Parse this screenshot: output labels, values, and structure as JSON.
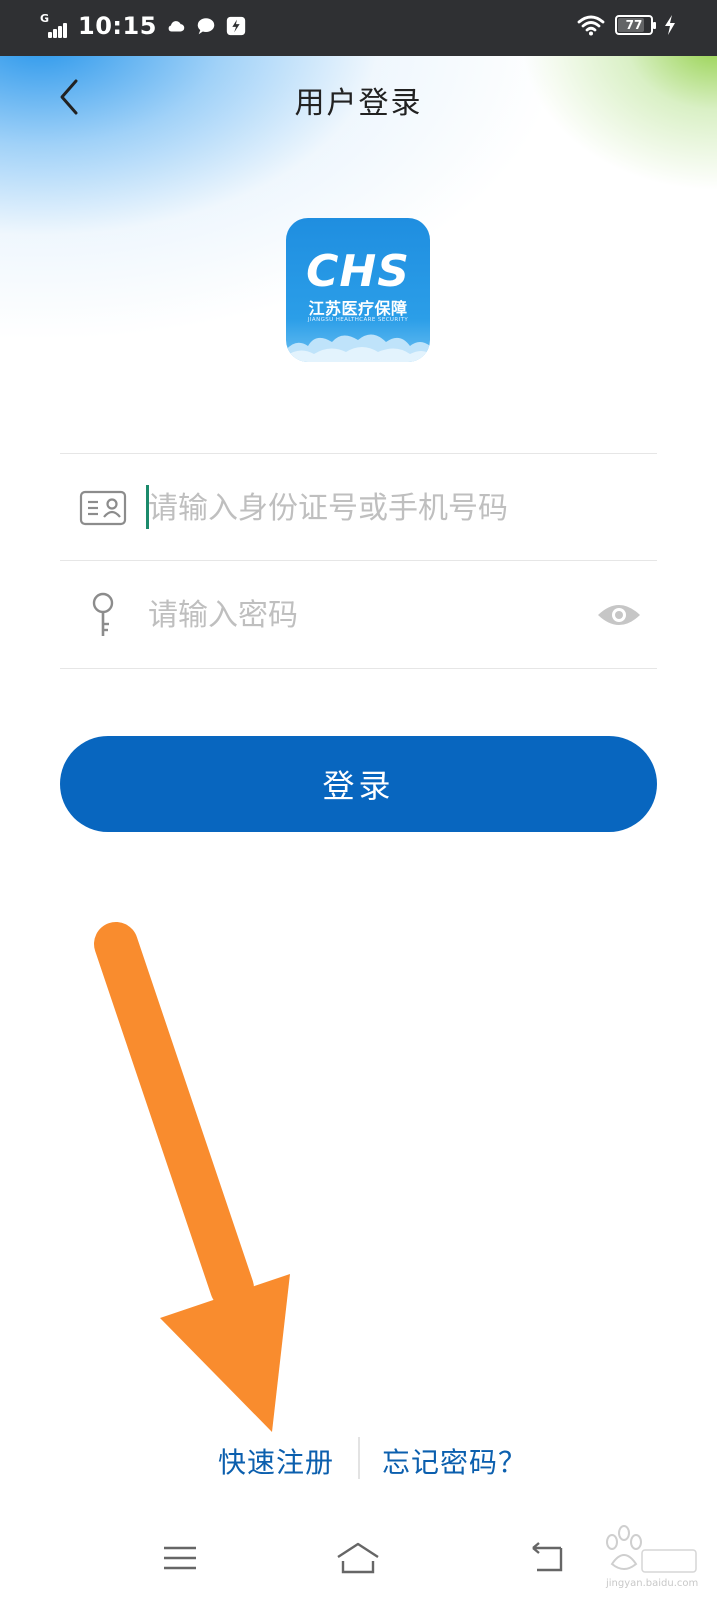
{
  "status_bar": {
    "network": "G",
    "time": "10:15",
    "battery_level": "77"
  },
  "header": {
    "title": "用户登录"
  },
  "logo": {
    "text_main": "CHS",
    "text_cn": "江苏医疗保障",
    "text_en": "JIANGSU HEALTHCARE SECURITY"
  },
  "form": {
    "id_placeholder": "请输入身份证号或手机号码",
    "id_value": "",
    "password_placeholder": "请输入密码",
    "password_value": "",
    "login_label": "登录"
  },
  "links": {
    "register": "快速注册",
    "forgot": "忘记密码？"
  },
  "watermark": {
    "site": "jingyan.baidu.com"
  },
  "colors": {
    "primary": "#0866bf",
    "link": "#0b5fae",
    "annotation_arrow": "#f98c2e"
  },
  "icons": {
    "back": "chevron-left-icon",
    "id": "id-card-icon",
    "password": "key-icon",
    "toggle": "eye-icon",
    "menu": "menu-icon",
    "home": "home-icon",
    "back_nav": "back-nav-icon"
  }
}
